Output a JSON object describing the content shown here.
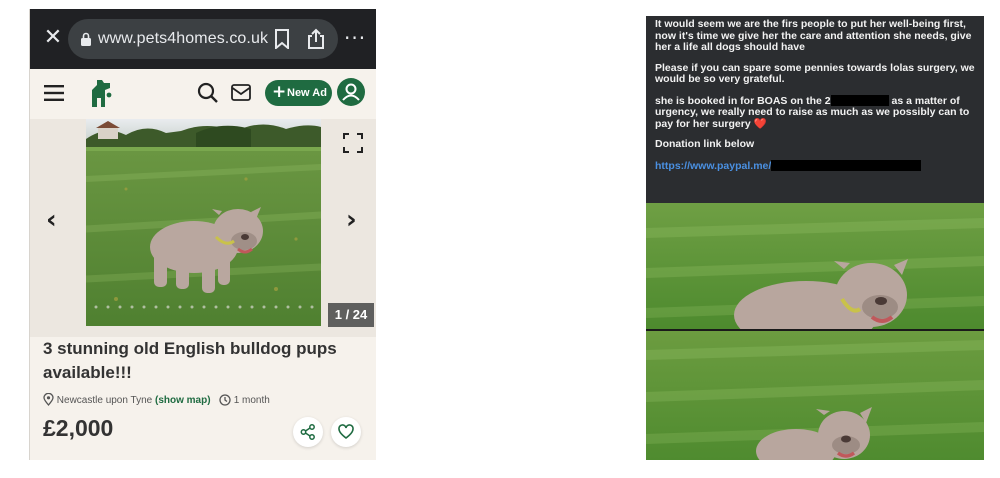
{
  "listing": {
    "browser": {
      "url": "www.pets4homes.co.uk",
      "close_icon": "close-icon",
      "more_icon": "more-icon"
    },
    "nav": {
      "new_ad_label": "New Ad",
      "new_ad_symbol": "+"
    },
    "gallery": {
      "counter": "1 / 24",
      "prev_symbol": "‹",
      "next_symbol": "›"
    },
    "title": "3 stunning old English bulldog pups available!!!",
    "location": "Newcastle upon Tyne",
    "show_map": "(show map)",
    "age": "1 month",
    "price": "£2,000",
    "colors": {
      "brand": "#1f6b41",
      "page_bg": "#f6f2ec"
    }
  },
  "post": {
    "paragraph_1": "It would seem we are the firs people to put her well-being first, now it's time we give her the care and attention she needs, give her a life all dogs should have",
    "paragraph_2": "Please if you can spare some pennies towards lolas surgery, we would be so very grateful.",
    "paragraph_3_start": "she is booked in for BOAS on the 2",
    "paragraph_3_end": " as a matter of urgency, we really need to raise as much as we possibly can to pay for her surgery",
    "heart": "❤️",
    "donation_label": "Donation link below",
    "donation_link": "https://www.paypal.me/",
    "colors": {
      "link": "#4a90e2",
      "bg": "#2b2d30"
    }
  }
}
